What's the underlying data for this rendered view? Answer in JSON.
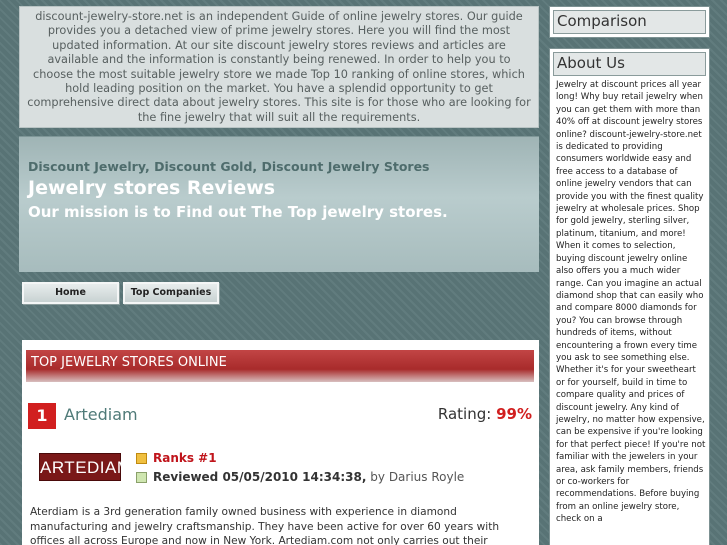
{
  "intro": {
    "text": "discount-jewelry-store.net is an independent Guide of online jewelry stores. Our guide provides you a detached view of prime jewelry stores. Here you will find the most updated information. At our site discount jewelry stores reviews and articles are available and the information is constantly being renewed. In order to help you to choose the most suitable jewelry store we made Top 10 ranking of online stores, which hold leading position on the market. You have a splendid opportunity to get comprehensive direct data about jewelry stores. This site is for those who are looking for the fine jewelry that will suit all the requirements."
  },
  "hero": {
    "tags": "Discount Jewelry, Discount Gold, Discount Jewelry Stores",
    "title": "Jewelry stores Reviews",
    "mission": "Our mission is to Find out The Top jewelry stores."
  },
  "nav": {
    "home": "Home",
    "top_companies": "Top Companies"
  },
  "section": {
    "title": "TOP JEWELRY STORES ONLINE"
  },
  "entry": {
    "rank_number": "1",
    "name": "Artediam",
    "rating_label": "Rating:",
    "rating_value": "99%",
    "logo_text": "ARTEDIAM",
    "ranks_text": "Ranks #1",
    "reviewed_text": "Reviewed 05/05/2010 14:34:38,",
    "reviewer_text": "by Darius Royle",
    "description": "Aterdiam is a 3rd generation family owned business with experience in diamond manufacturing and jewelry craftsmanship. They have been active for over 60 years with offices all across Europe and now in New York. Artediam.com not only carries out their heritage but stays on top"
  },
  "sidebar": {
    "comparison_title": "Comparison",
    "about_title": "About Us",
    "about_text": "Jewelry at discount prices all year long! Why buy retail jewelry when you can get them with more than 40% off at discount jewelry stores online? discount-jewelry-store.net is dedicated to providing consumers worldwide easy and free access to a database of online jewelry vendors that can provide you with the finest quality jewelry at wholesale prices. Shop for gold jewelry, sterling silver, platinum, titanium, and more! When it comes to selection, buying discount jewelry online also offers you a much wider range. Can you imagine an actual diamond shop that can easily who and compare 8000 diamonds for you? You can browse through hundreds of items, without encountering a frown every time you ask to see something else. Whether it's for your sweetheart or for yourself, build in time to compare quality and prices of discount jewelry. Any kind of jewelry, no matter how expensive, can be expensive if you're looking for that perfect piece! If you're not familiar with the jewelers in your area, ask family members, friends or co-workers for recommendations. Before buying from an online jewelry store, check on a"
  },
  "colors": {
    "accent_red": "#d11f1f",
    "section_bar": "#b83535",
    "background": "#5b7779",
    "link_teal": "#4f7a78"
  }
}
